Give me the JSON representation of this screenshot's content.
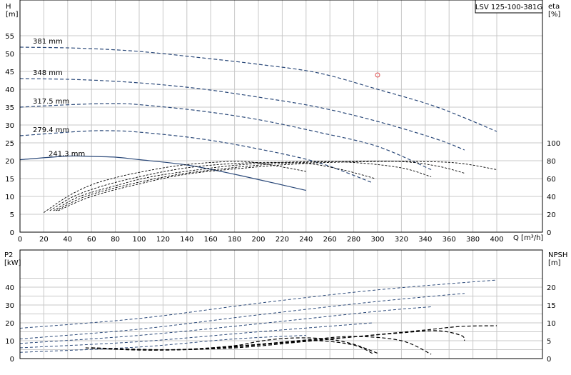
{
  "title": "LSV 125-100-381G",
  "colors": {
    "pump": "#2c4a7a",
    "eff": "#000000",
    "npsh": "#000000",
    "power": "#2c4a7a",
    "grid": "#c8c8c8",
    "marker": "#e05050"
  },
  "chart_data": [
    {
      "id": "performance",
      "type": "line",
      "xlabel": "Q [m³/h]",
      "ylabel": "H\n[m]",
      "y2label": "eta\n[%]",
      "xlim": [
        0,
        420
      ],
      "ylim": [
        0,
        60
      ],
      "y2lim": [
        0,
        240
      ],
      "xticks": [
        0,
        20,
        40,
        60,
        80,
        100,
        120,
        140,
        160,
        180,
        200,
        220,
        240,
        260,
        280,
        300,
        320,
        340,
        360,
        380,
        400
      ],
      "yticks": [
        0,
        5,
        10,
        15,
        20,
        25,
        30,
        35,
        40,
        45,
        50,
        55
      ],
      "y2ticks": [
        0,
        20,
        40,
        60,
        80,
        100
      ],
      "grid": true,
      "head_series": [
        {
          "name": "381 mm",
          "x": [
            0,
            50,
            100,
            150,
            200,
            250,
            300,
            350,
            400
          ],
          "y": [
            51.8,
            51.5,
            50.6,
            48.9,
            47.0,
            44.6,
            40.0,
            35.0,
            28.2
          ]
        },
        {
          "name": "348 mm",
          "x": [
            0,
            50,
            100,
            150,
            200,
            250,
            300,
            350,
            373
          ],
          "y": [
            43.0,
            42.7,
            41.8,
            40.2,
            37.8,
            35.0,
            31.0,
            26.0,
            23.0
          ]
        },
        {
          "name": "317.5 mm",
          "x": [
            0,
            50,
            80,
            100,
            150,
            200,
            250,
            300,
            345
          ],
          "y": [
            35.0,
            35.8,
            36.0,
            35.7,
            34.0,
            31.5,
            28.0,
            24.0,
            17.5
          ]
        },
        {
          "name": "279.4 mm",
          "x": [
            0,
            50,
            75,
            100,
            150,
            200,
            250,
            296
          ],
          "y": [
            27.0,
            28.2,
            28.4,
            28.0,
            26.2,
            23.3,
            19.5,
            13.8
          ]
        },
        {
          "name": "241.3 mm",
          "x": [
            0,
            40,
            60,
            80,
            100,
            140,
            180,
            240
          ],
          "y": [
            20.3,
            21.3,
            21.2,
            21.0,
            20.3,
            18.8,
            16.2,
            11.7
          ]
        }
      ],
      "eff_series": [
        {
          "x": [
            20,
            40,
            60,
            80,
            100,
            130,
            160,
            190,
            220,
            240
          ],
          "y": [
            22,
            40,
            53,
            61,
            67,
            74,
            78,
            79,
            73,
            68
          ]
        },
        {
          "x": [
            25,
            45,
            70,
            100,
            130,
            160,
            200,
            240,
            270,
            298
          ],
          "y": [
            24,
            40,
            52,
            62,
            70,
            75,
            78,
            77,
            70,
            60
          ]
        },
        {
          "x": [
            28,
            50,
            80,
            110,
            150,
            190,
            240,
            280,
            320,
            345
          ],
          "y": [
            24,
            40,
            52,
            62,
            70,
            76,
            79,
            78,
            72,
            62
          ]
        },
        {
          "x": [
            30,
            55,
            90,
            130,
            170,
            220,
            270,
            320,
            350,
            373
          ],
          "y": [
            24,
            40,
            53,
            64,
            71,
            77,
            79,
            79,
            74,
            66
          ]
        },
        {
          "x": [
            32,
            60,
            100,
            140,
            190,
            240,
            290,
            340,
            370,
            400
          ],
          "y": [
            24,
            40,
            54,
            65,
            72,
            77,
            79,
            79,
            77,
            70
          ]
        }
      ],
      "marker": {
        "x": 300,
        "y": 44
      }
    },
    {
      "id": "power_npsh",
      "type": "line",
      "ylabel": "P2\n[kW]",
      "y2label": "NPSH\n[m]",
      "xlim": [
        0,
        420
      ],
      "ylim": [
        0,
        50
      ],
      "y2lim": [
        0,
        25
      ],
      "yticks": [
        0,
        10,
        20,
        30,
        40
      ],
      "y2ticks": [
        0,
        5,
        10,
        15,
        20
      ],
      "grid": true,
      "power_series": [
        {
          "x": [
            0,
            100,
            200,
            300,
            400
          ],
          "y": [
            17,
            22.5,
            31,
            38.5,
            44
          ]
        },
        {
          "x": [
            0,
            100,
            200,
            300,
            373
          ],
          "y": [
            11,
            16.5,
            24.5,
            32,
            36.5
          ]
        },
        {
          "x": [
            0,
            100,
            200,
            300,
            345
          ],
          "y": [
            8.5,
            13,
            19.5,
            26.5,
            29
          ]
        },
        {
          "x": [
            0,
            100,
            200,
            296
          ],
          "y": [
            6,
            9.5,
            15,
            20
          ]
        },
        {
          "x": [
            0,
            100,
            180,
            240
          ],
          "y": [
            3.5,
            6.5,
            11,
            13
          ]
        }
      ],
      "npsh_series": [
        {
          "x": [
            55,
            100,
            140,
            180,
            200,
            220,
            240,
            260,
            280,
            300
          ],
          "y": [
            3.0,
            2.4,
            2.6,
            3.6,
            4.8,
            5.6,
            5.8,
            5.4,
            4.0,
            1.5
          ]
        },
        {
          "x": [
            60,
            110,
            150,
            200,
            240,
            280,
            320,
            345
          ],
          "y": [
            3.0,
            2.4,
            2.7,
            4.0,
            5.2,
            6.2,
            5.0,
            1.2
          ]
        },
        {
          "x": [
            60,
            110,
            160,
            220,
            270,
            320,
            350,
            370,
            373
          ],
          "y": [
            3.0,
            2.4,
            2.8,
            4.4,
            5.8,
            7.2,
            7.8,
            6.5,
            5.0
          ]
        },
        {
          "x": [
            60,
            120,
            180,
            240,
            290,
            340,
            370,
            400
          ],
          "y": [
            3.0,
            2.5,
            3.0,
            4.8,
            6.4,
            8.0,
            9.0,
            9.2
          ]
        },
        {
          "x": [
            60,
            100,
            140,
            180,
            220,
            250,
            280,
            296
          ],
          "y": [
            3.0,
            2.4,
            2.6,
            3.4,
            4.5,
            5.0,
            3.8,
            1.4
          ]
        }
      ]
    }
  ]
}
